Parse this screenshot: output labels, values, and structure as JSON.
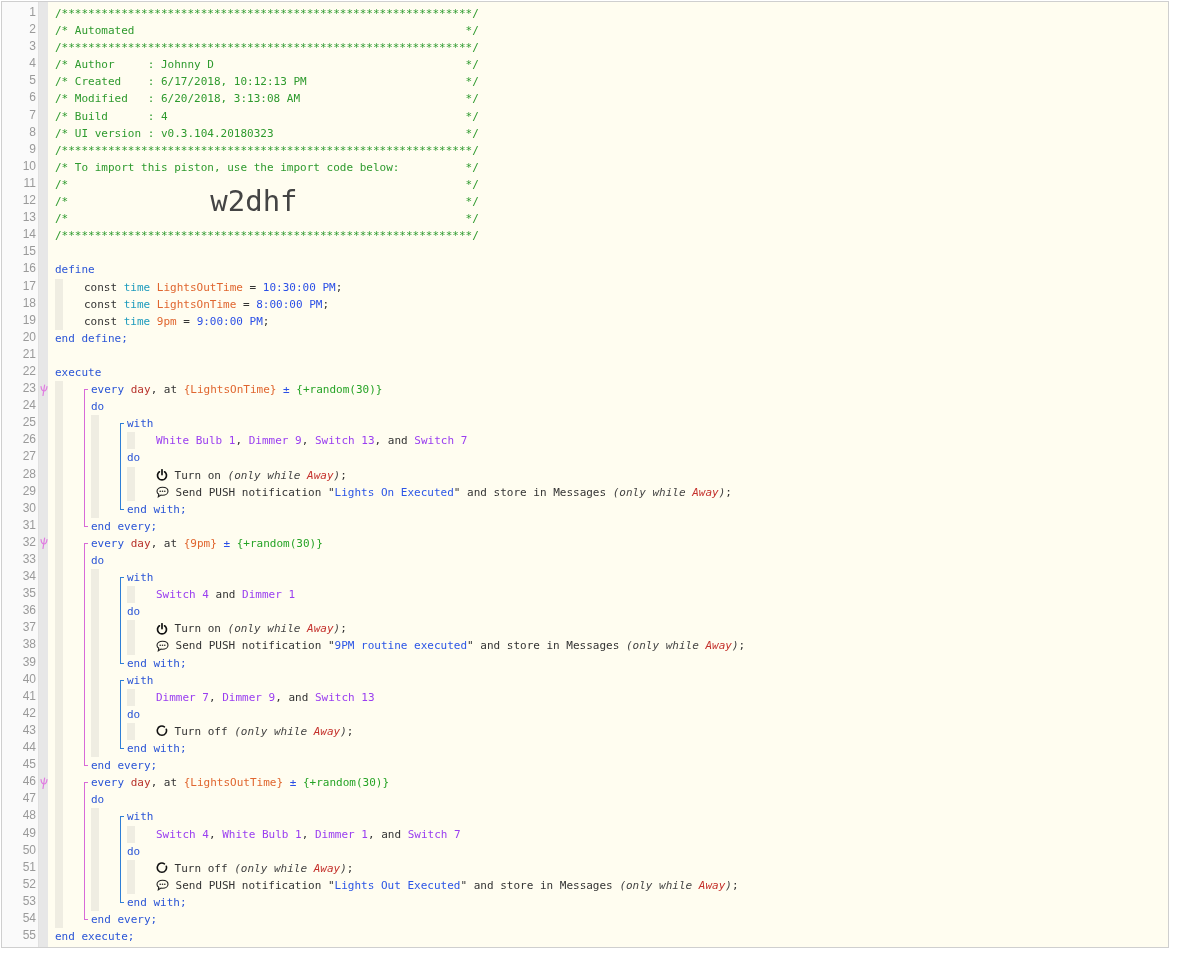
{
  "editor": {
    "items": [
      {
        "kind": "line",
        "number": "1",
        "trigger": false,
        "tokens": [
          {
            "text": "/**************************************************************/",
            "kind": "comment"
          }
        ]
      },
      {
        "kind": "line",
        "number": "2",
        "trigger": false,
        "tokens": [
          {
            "text": "/* Automated",
            "kind": "comment"
          },
          {
            "text": "*/",
            "kind": "comment-end"
          }
        ]
      },
      {
        "kind": "line",
        "number": "3",
        "trigger": false,
        "tokens": [
          {
            "text": "/**************************************************************/",
            "kind": "comment"
          }
        ]
      },
      {
        "kind": "line",
        "number": "4",
        "trigger": false,
        "tokens": [
          {
            "text": "/* Author     : Johnny D",
            "kind": "comment"
          },
          {
            "text": "*/",
            "kind": "comment-end"
          }
        ]
      },
      {
        "kind": "line",
        "number": "5",
        "trigger": false,
        "tokens": [
          {
            "text": "/* Created    : 6/17/2018, 10:12:13 PM",
            "kind": "comment"
          },
          {
            "text": "*/",
            "kind": "comment-end"
          }
        ]
      },
      {
        "kind": "line",
        "number": "6",
        "trigger": false,
        "tokens": [
          {
            "text": "/* Modified   : 6/20/2018, 3:13:08 AM",
            "kind": "comment"
          },
          {
            "text": "*/",
            "kind": "comment-end"
          }
        ]
      },
      {
        "kind": "line",
        "number": "7",
        "trigger": false,
        "tokens": [
          {
            "text": "/* Build      : 4",
            "kind": "comment"
          },
          {
            "text": "*/",
            "kind": "comment-end"
          }
        ]
      },
      {
        "kind": "line",
        "number": "8",
        "trigger": false,
        "tokens": [
          {
            "text": "/* UI version : v0.3.104.20180323",
            "kind": "comment"
          },
          {
            "text": "*/",
            "kind": "comment-end"
          }
        ]
      },
      {
        "kind": "line",
        "number": "9",
        "trigger": false,
        "tokens": [
          {
            "text": "/**************************************************************/",
            "kind": "comment"
          }
        ]
      },
      {
        "kind": "line",
        "number": "10",
        "trigger": false,
        "tokens": [
          {
            "text": "/* To import this piston, use the import code below:",
            "kind": "comment"
          },
          {
            "text": "*/",
            "kind": "comment-end"
          }
        ]
      },
      {
        "kind": "line",
        "number": "11",
        "trigger": false,
        "tokens": [
          {
            "text": "/*",
            "kind": "comment"
          },
          {
            "text": "*/",
            "kind": "comment-end"
          }
        ]
      },
      {
        "kind": "line",
        "number": "12",
        "trigger": false,
        "tokens": [
          {
            "text": "/*",
            "kind": "comment"
          },
          {
            "text": "w2dhf",
            "kind": "import-code"
          },
          {
            "text": "*/",
            "kind": "comment-end"
          }
        ]
      },
      {
        "kind": "line",
        "number": "13",
        "trigger": false,
        "tokens": [
          {
            "text": "/*",
            "kind": "comment"
          },
          {
            "text": "*/",
            "kind": "comment-end"
          }
        ]
      },
      {
        "kind": "line",
        "number": "14",
        "trigger": false,
        "tokens": [
          {
            "text": "/**************************************************************/",
            "kind": "comment"
          }
        ]
      },
      {
        "kind": "line",
        "number": "15",
        "trigger": false
      },
      {
        "kind": "line",
        "number": "16",
        "trigger": false,
        "tokens": [
          {
            "text": "define",
            "kind": "keyword"
          }
        ]
      },
      {
        "kind": "indent",
        "children": [
          {
            "kind": "line",
            "number": "17",
            "trigger": false,
            "tokens": [
              {
                "text": "const ",
                "kind": "plain"
              },
              {
                "text": "time",
                "kind": "type"
              },
              {
                "text": " LightsOutTime",
                "kind": "variable"
              },
              {
                "text": " = ",
                "kind": "plain"
              },
              {
                "text": "10:30:00 PM",
                "kind": "value"
              },
              {
                "text": ";",
                "kind": "plain"
              }
            ]
          },
          {
            "kind": "line",
            "number": "18",
            "trigger": false,
            "tokens": [
              {
                "text": "const ",
                "kind": "plain"
              },
              {
                "text": "time",
                "kind": "type"
              },
              {
                "text": " LightsOnTime",
                "kind": "variable"
              },
              {
                "text": " = ",
                "kind": "plain"
              },
              {
                "text": "8:00:00 PM",
                "kind": "value"
              },
              {
                "text": ";",
                "kind": "plain"
              }
            ]
          },
          {
            "kind": "line",
            "number": "19",
            "trigger": false,
            "tokens": [
              {
                "text": "const ",
                "kind": "plain"
              },
              {
                "text": "time",
                "kind": "type"
              },
              {
                "text": " 9pm",
                "kind": "variable"
              },
              {
                "text": " = ",
                "kind": "plain"
              },
              {
                "text": "9:00:00 PM",
                "kind": "value"
              },
              {
                "text": ";",
                "kind": "plain"
              }
            ]
          }
        ]
      },
      {
        "kind": "line",
        "number": "20",
        "trigger": false,
        "tokens": [
          {
            "text": "end define;",
            "kind": "keyword"
          }
        ]
      },
      {
        "kind": "line",
        "number": "21",
        "trigger": false
      },
      {
        "kind": "line",
        "number": "22",
        "trigger": false,
        "tokens": [
          {
            "text": "execute",
            "kind": "keyword"
          }
        ]
      },
      {
        "kind": "indent",
        "children": [
          {
            "kind": "every-block",
            "items": [
              {
                "kind": "line",
                "number": "23",
                "trigger": true,
                "tokens": [
                  {
                    "text": "every",
                    "kind": "keyword"
                  },
                  {
                    "text": " day",
                    "kind": "unit"
                  },
                  {
                    "text": ", at ",
                    "kind": "plain"
                  },
                  {
                    "text": "{LightsOnTime}",
                    "kind": "variable"
                  },
                  {
                    "text": " ± ",
                    "kind": "value"
                  },
                  {
                    "text": "{+random(30)}",
                    "kind": "expression"
                  }
                ]
              },
              {
                "kind": "line",
                "number": "24",
                "trigger": false,
                "tokens": [
                  {
                    "text": "do",
                    "kind": "keyword"
                  }
                ]
              },
              {
                "kind": "indent",
                "children": [
                  {
                    "kind": "with-block",
                    "items": [
                      {
                        "kind": "line",
                        "number": "25",
                        "trigger": false,
                        "tokens": [
                          {
                            "text": "with",
                            "kind": "keyword"
                          }
                        ]
                      },
                      {
                        "kind": "indent",
                        "children": [
                          {
                            "kind": "line",
                            "number": "26",
                            "trigger": false,
                            "tokens": [
                              {
                                "text": "White Bulb 1",
                                "kind": "device"
                              },
                              {
                                "text": ", ",
                                "kind": "plain"
                              },
                              {
                                "text": "Dimmer 9",
                                "kind": "device"
                              },
                              {
                                "text": ", ",
                                "kind": "plain"
                              },
                              {
                                "text": "Switch 13",
                                "kind": "device"
                              },
                              {
                                "text": ", and ",
                                "kind": "plain"
                              },
                              {
                                "text": "Switch 7",
                                "kind": "device"
                              }
                            ]
                          }
                        ]
                      },
                      {
                        "kind": "line",
                        "number": "27",
                        "trigger": false,
                        "tokens": [
                          {
                            "text": "do",
                            "kind": "keyword"
                          }
                        ]
                      },
                      {
                        "kind": "indent",
                        "children": [
                          {
                            "kind": "line",
                            "number": "28",
                            "trigger": false,
                            "tokens": [
                              {
                                "kind": "power-icon"
                              },
                              {
                                "text": " Turn on ",
                                "kind": "plain"
                              },
                              {
                                "text": "(only while ",
                                "kind": "italic"
                              },
                              {
                                "text": "Away",
                                "kind": "location"
                              },
                              {
                                "text": ")",
                                "kind": "italic"
                              },
                              {
                                "text": ";",
                                "kind": "plain"
                              }
                            ]
                          },
                          {
                            "kind": "line",
                            "number": "29",
                            "trigger": false,
                            "tokens": [
                              {
                                "kind": "chat-icon"
                              },
                              {
                                "text": " Send PUSH notification \"",
                                "kind": "plain"
                              },
                              {
                                "text": "Lights On Executed",
                                "kind": "string"
                              },
                              {
                                "text": "\" and store in Messages ",
                                "kind": "plain"
                              },
                              {
                                "text": "(only while ",
                                "kind": "italic"
                              },
                              {
                                "text": "Away",
                                "kind": "location"
                              },
                              {
                                "text": ")",
                                "kind": "italic"
                              },
                              {
                                "text": ";",
                                "kind": "plain"
                              }
                            ]
                          }
                        ]
                      },
                      {
                        "kind": "line",
                        "number": "30",
                        "trigger": false,
                        "tokens": [
                          {
                            "text": "end with;",
                            "kind": "keyword"
                          }
                        ]
                      }
                    ]
                  }
                ]
              },
              {
                "kind": "line",
                "number": "31",
                "trigger": false,
                "tokens": [
                  {
                    "text": "end every;",
                    "kind": "keyword"
                  }
                ]
              }
            ]
          },
          {
            "kind": "every-block",
            "items": [
              {
                "kind": "line",
                "number": "32",
                "trigger": true,
                "tokens": [
                  {
                    "text": "every",
                    "kind": "keyword"
                  },
                  {
                    "text": " day",
                    "kind": "unit"
                  },
                  {
                    "text": ", at ",
                    "kind": "plain"
                  },
                  {
                    "text": "{9pm}",
                    "kind": "variable"
                  },
                  {
                    "text": " ± ",
                    "kind": "value"
                  },
                  {
                    "text": "{+random(30)}",
                    "kind": "expression"
                  }
                ]
              },
              {
                "kind": "line",
                "number": "33",
                "trigger": false,
                "tokens": [
                  {
                    "text": "do",
                    "kind": "keyword"
                  }
                ]
              },
              {
                "kind": "indent",
                "children": [
                  {
                    "kind": "with-block",
                    "items": [
                      {
                        "kind": "line",
                        "number": "34",
                        "trigger": false,
                        "tokens": [
                          {
                            "text": "with",
                            "kind": "keyword"
                          }
                        ]
                      },
                      {
                        "kind": "indent",
                        "children": [
                          {
                            "kind": "line",
                            "number": "35",
                            "trigger": false,
                            "tokens": [
                              {
                                "text": "Switch 4",
                                "kind": "device"
                              },
                              {
                                "text": " and ",
                                "kind": "plain"
                              },
                              {
                                "text": "Dimmer 1",
                                "kind": "device"
                              }
                            ]
                          }
                        ]
                      },
                      {
                        "kind": "line",
                        "number": "36",
                        "trigger": false,
                        "tokens": [
                          {
                            "text": "do",
                            "kind": "keyword"
                          }
                        ]
                      },
                      {
                        "kind": "indent",
                        "children": [
                          {
                            "kind": "line",
                            "number": "37",
                            "trigger": false,
                            "tokens": [
                              {
                                "kind": "power-icon"
                              },
                              {
                                "text": " Turn on ",
                                "kind": "plain"
                              },
                              {
                                "text": "(only while ",
                                "kind": "italic"
                              },
                              {
                                "text": "Away",
                                "kind": "location"
                              },
                              {
                                "text": ")",
                                "kind": "italic"
                              },
                              {
                                "text": ";",
                                "kind": "plain"
                              }
                            ]
                          },
                          {
                            "kind": "line",
                            "number": "38",
                            "trigger": false,
                            "tokens": [
                              {
                                "kind": "chat-icon"
                              },
                              {
                                "text": " Send PUSH notification \"",
                                "kind": "plain"
                              },
                              {
                                "text": "9PM routine executed",
                                "kind": "string"
                              },
                              {
                                "text": "\" and store in Messages ",
                                "kind": "plain"
                              },
                              {
                                "text": "(only while ",
                                "kind": "italic"
                              },
                              {
                                "text": "Away",
                                "kind": "location"
                              },
                              {
                                "text": ")",
                                "kind": "italic"
                              },
                              {
                                "text": ";",
                                "kind": "plain"
                              }
                            ]
                          }
                        ]
                      },
                      {
                        "kind": "line",
                        "number": "39",
                        "trigger": false,
                        "tokens": [
                          {
                            "text": "end with;",
                            "kind": "keyword"
                          }
                        ]
                      }
                    ]
                  },
                  {
                    "kind": "with-block",
                    "items": [
                      {
                        "kind": "line",
                        "number": "40",
                        "trigger": false,
                        "tokens": [
                          {
                            "text": "with",
                            "kind": "keyword"
                          }
                        ]
                      },
                      {
                        "kind": "indent",
                        "children": [
                          {
                            "kind": "line",
                            "number": "41",
                            "trigger": false,
                            "tokens": [
                              {
                                "text": "Dimmer 7",
                                "kind": "device"
                              },
                              {
                                "text": ", ",
                                "kind": "plain"
                              },
                              {
                                "text": "Dimmer 9",
                                "kind": "device"
                              },
                              {
                                "text": ", and ",
                                "kind": "plain"
                              },
                              {
                                "text": "Switch 13",
                                "kind": "device"
                              }
                            ]
                          }
                        ]
                      },
                      {
                        "kind": "line",
                        "number": "42",
                        "trigger": false,
                        "tokens": [
                          {
                            "text": "do",
                            "kind": "keyword"
                          }
                        ]
                      },
                      {
                        "kind": "indent",
                        "children": [
                          {
                            "kind": "line",
                            "number": "43",
                            "trigger": false,
                            "tokens": [
                              {
                                "kind": "ring-icon"
                              },
                              {
                                "text": " Turn off ",
                                "kind": "plain"
                              },
                              {
                                "text": "(only while ",
                                "kind": "italic"
                              },
                              {
                                "text": "Away",
                                "kind": "location"
                              },
                              {
                                "text": ")",
                                "kind": "italic"
                              },
                              {
                                "text": ";",
                                "kind": "plain"
                              }
                            ]
                          }
                        ]
                      },
                      {
                        "kind": "line",
                        "number": "44",
                        "trigger": false,
                        "tokens": [
                          {
                            "text": "end with;",
                            "kind": "keyword"
                          }
                        ]
                      }
                    ]
                  }
                ]
              },
              {
                "kind": "line",
                "number": "45",
                "trigger": false,
                "tokens": [
                  {
                    "text": "end every;",
                    "kind": "keyword"
                  }
                ]
              }
            ]
          },
          {
            "kind": "every-block",
            "items": [
              {
                "kind": "line",
                "number": "46",
                "trigger": true,
                "tokens": [
                  {
                    "text": "every",
                    "kind": "keyword"
                  },
                  {
                    "text": " day",
                    "kind": "unit"
                  },
                  {
                    "text": ", at ",
                    "kind": "plain"
                  },
                  {
                    "text": "{LightsOutTime}",
                    "kind": "variable"
                  },
                  {
                    "text": " ± ",
                    "kind": "value"
                  },
                  {
                    "text": "{+random(30)}",
                    "kind": "expression"
                  }
                ]
              },
              {
                "kind": "line",
                "number": "47",
                "trigger": false,
                "tokens": [
                  {
                    "text": "do",
                    "kind": "keyword"
                  }
                ]
              },
              {
                "kind": "indent",
                "children": [
                  {
                    "kind": "with-block",
                    "items": [
                      {
                        "kind": "line",
                        "number": "48",
                        "trigger": false,
                        "tokens": [
                          {
                            "text": "with",
                            "kind": "keyword"
                          }
                        ]
                      },
                      {
                        "kind": "indent",
                        "children": [
                          {
                            "kind": "line",
                            "number": "49",
                            "trigger": false,
                            "tokens": [
                              {
                                "text": "Switch 4",
                                "kind": "device"
                              },
                              {
                                "text": ", ",
                                "kind": "plain"
                              },
                              {
                                "text": "White Bulb 1",
                                "kind": "device"
                              },
                              {
                                "text": ", ",
                                "kind": "plain"
                              },
                              {
                                "text": "Dimmer 1",
                                "kind": "device"
                              },
                              {
                                "text": ", and ",
                                "kind": "plain"
                              },
                              {
                                "text": "Switch 7",
                                "kind": "device"
                              }
                            ]
                          }
                        ]
                      },
                      {
                        "kind": "line",
                        "number": "50",
                        "trigger": false,
                        "tokens": [
                          {
                            "text": "do",
                            "kind": "keyword"
                          }
                        ]
                      },
                      {
                        "kind": "indent",
                        "children": [
                          {
                            "kind": "line",
                            "number": "51",
                            "trigger": false,
                            "tokens": [
                              {
                                "kind": "ring-icon"
                              },
                              {
                                "text": " Turn off ",
                                "kind": "plain"
                              },
                              {
                                "text": "(only while ",
                                "kind": "italic"
                              },
                              {
                                "text": "Away",
                                "kind": "location"
                              },
                              {
                                "text": ")",
                                "kind": "italic"
                              },
                              {
                                "text": ";",
                                "kind": "plain"
                              }
                            ]
                          },
                          {
                            "kind": "line",
                            "number": "52",
                            "trigger": false,
                            "tokens": [
                              {
                                "kind": "chat-icon"
                              },
                              {
                                "text": " Send PUSH notification \"",
                                "kind": "plain"
                              },
                              {
                                "text": "Lights Out Executed",
                                "kind": "string"
                              },
                              {
                                "text": "\" and store in Messages ",
                                "kind": "plain"
                              },
                              {
                                "text": "(only while ",
                                "kind": "italic"
                              },
                              {
                                "text": "Away",
                                "kind": "location"
                              },
                              {
                                "text": ")",
                                "kind": "italic"
                              },
                              {
                                "text": ";",
                                "kind": "plain"
                              }
                            ]
                          }
                        ]
                      },
                      {
                        "kind": "line",
                        "number": "53",
                        "trigger": false,
                        "tokens": [
                          {
                            "text": "end with;",
                            "kind": "keyword"
                          }
                        ]
                      }
                    ]
                  }
                ]
              },
              {
                "kind": "line",
                "number": "54",
                "trigger": false,
                "tokens": [
                  {
                    "text": "end every;",
                    "kind": "keyword"
                  }
                ]
              }
            ]
          }
        ]
      },
      {
        "kind": "line",
        "number": "55",
        "trigger": false,
        "tokens": [
          {
            "text": "end execute;",
            "kind": "keyword"
          }
        ]
      }
    ]
  }
}
